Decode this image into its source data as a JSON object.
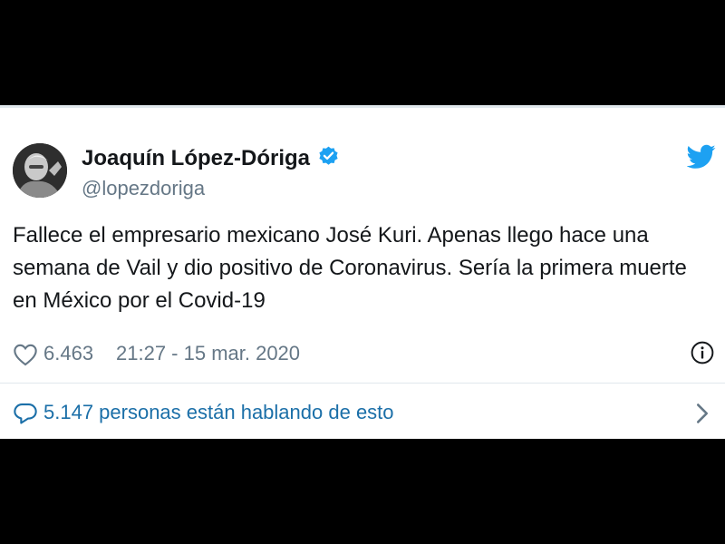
{
  "tweet": {
    "display_name": "Joaquín López-Dóriga",
    "handle": "@lopezdoriga",
    "text": "Fallece el empresario mexicano José Kuri. Apenas llego hace una semana de Vail y dio positivo de Coronavirus. Sería la primera muerte en México por el Covid-19",
    "likes": "6.463",
    "timestamp": "21:27 - 15 mar. 2020",
    "talking": "5.147 personas están hablando de esto"
  },
  "icons": {
    "verified": "verified-badge-icon",
    "logo": "twitter-bird-icon",
    "like": "heart-icon",
    "info": "info-icon",
    "reply": "speech-bubble-icon",
    "chevron": "chevron-right-icon"
  },
  "colors": {
    "accent": "#1da1f2",
    "link": "#1b6fa8",
    "secondary_text": "#657786",
    "primary_text": "#14171a"
  }
}
